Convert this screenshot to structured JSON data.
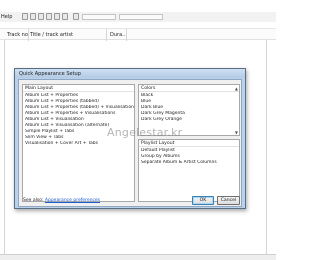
{
  "app": {
    "menu": [
      "Help"
    ],
    "columns": [
      "Track no",
      "Title / track artist",
      "Dura..."
    ]
  },
  "dialog": {
    "title": "Quick Appearance Setup",
    "main_layout": {
      "header": "Main Layout",
      "items": [
        "Album List + Properties",
        "Album List + Properties (tabbed)",
        "Album List + Properties (tabbed) + Visualisations",
        "Album List + Properties + Visualisations",
        "Album List + Visualisation",
        "Album List + Visualisation (alternate)",
        "Simple Playlist + Tabs",
        "Slim View + Tabs",
        "Visualisation + Cover Art + Tabs"
      ]
    },
    "colors": {
      "header": "Colors",
      "items": [
        "Black",
        "Blue",
        "Dark Blue",
        "Dark Grey Magenta",
        "Dark Grey Orange"
      ]
    },
    "playlist_layout": {
      "header": "Playlist Layout",
      "items": [
        "Default Playlist",
        "Group by Albums",
        "Separate Album & Artist Columns"
      ]
    },
    "footer": {
      "see_also": "See also:",
      "link": "Appearance preferences"
    },
    "buttons": {
      "ok": "OK",
      "cancel": "Cancel"
    }
  },
  "watermark": "Angelestar.kr",
  "colors": {
    "dialog_frame": "#b9d1ea",
    "link": "#1c5bd1",
    "body": "#f0f0f0"
  }
}
